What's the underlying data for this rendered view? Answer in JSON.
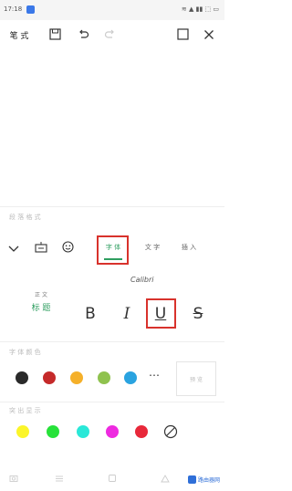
{
  "status_bar": {
    "time": "17:18",
    "right": "≋ ▲ ▮▮ ⬚ ▭"
  },
  "toolbar": {
    "left_label": "笔 式",
    "save_icon": "floppy-disk-icon",
    "undo_icon": "undo-icon",
    "fullscreen_icon": "square-icon",
    "close_icon": "close-icon"
  },
  "format_panel": {
    "section_paragraph": "段 落 格 式",
    "tabs": [
      "字 体",
      "文 字",
      "插 入"
    ],
    "active_tab": 0,
    "font_name": "Calibri",
    "style_left_top": "正 文",
    "style_left_bottom": "标 题",
    "format_buttons": [
      "B",
      "I",
      "U",
      "S"
    ]
  },
  "colors": {
    "section_font_color": "字 体 颜 色",
    "font_colors": [
      "#2a2a2a",
      "#c52a2a",
      "#f5b02a",
      "#8fc24e",
      "#2aa3e0"
    ],
    "preview_label": "预 览",
    "section_highlight": "突 出 显 示",
    "highlight_colors": [
      "#fbf52a",
      "#27e23a",
      "#2ae8d8",
      "#ee2ae0",
      "#e8283a"
    ]
  },
  "watermark": {
    "text": "路由器网"
  },
  "accent": "#2f9e60",
  "highlight_frame": "#d8322c"
}
